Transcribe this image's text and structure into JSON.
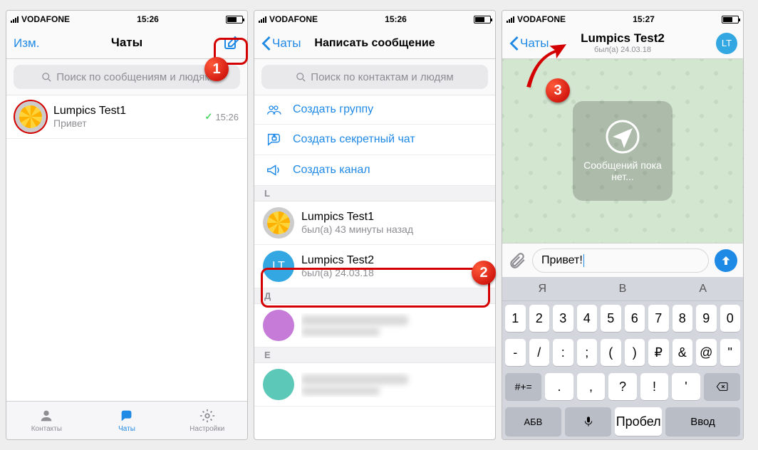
{
  "status": {
    "carrier": "VODAFONE",
    "time1": "15:26",
    "time2": "15:26",
    "time3": "15:27"
  },
  "s1": {
    "edit": "Изм.",
    "title": "Чаты",
    "search_ph": "Поиск по сообщениям и людям",
    "chat_name": "Lumpics Test1",
    "chat_sub": "Привет",
    "chat_time": "15:26",
    "tab_contacts": "Контакты",
    "tab_chats": "Чаты",
    "tab_settings": "Настройки"
  },
  "s2": {
    "back": "Чаты",
    "title": "Написать сообщение",
    "search_ph": "Поиск по контактам и людям",
    "act_group": "Создать группу",
    "act_secret": "Создать секретный чат",
    "act_channel": "Создать канал",
    "sec_L": "L",
    "c1_name": "Lumpics Test1",
    "c1_sub": "был(а) 43 минуты назад",
    "c2_name": "Lumpics Test2",
    "c2_sub": "был(а) 24.03.18",
    "c2_initials": "LT",
    "sec_D": "Д",
    "sec_E": "Е"
  },
  "s3": {
    "back": "Чаты",
    "title": "Lumpics Test2",
    "sub": "был(а) 24.03.18",
    "av": "LT",
    "empty": "Сообщений пока нет...",
    "input": "Привет!",
    "cand1": "Я",
    "cand2": "В",
    "cand3": "А",
    "space": "Пробел",
    "enter": "Ввод",
    "abc": "АБВ",
    "sym": "#+="
  },
  "marks": {
    "m1": "1",
    "m2": "2",
    "m3": "3"
  }
}
